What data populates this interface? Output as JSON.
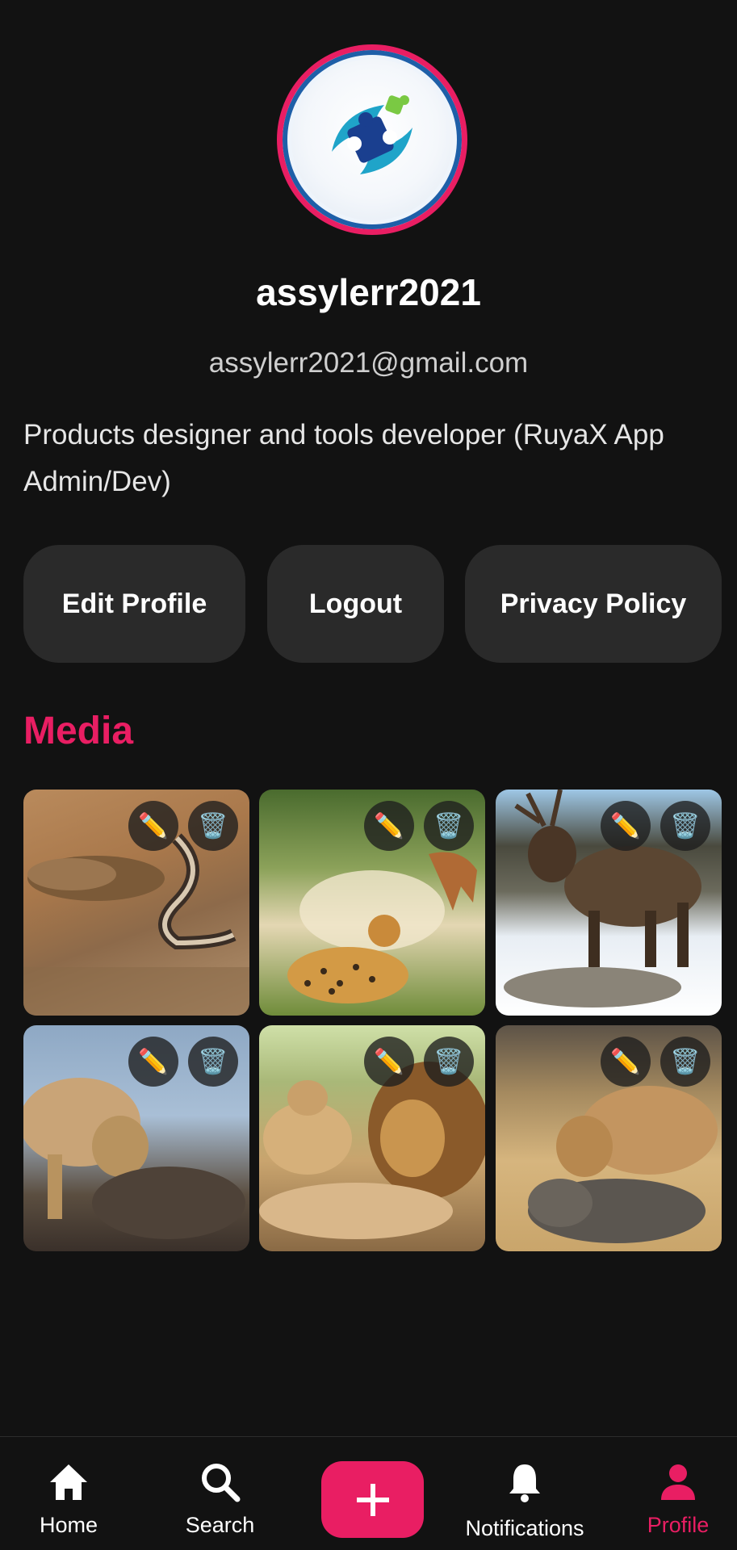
{
  "profile": {
    "username": "assylerr2021",
    "email": "assylerr2021@gmail.com",
    "bio": "Products designer and tools developer (RuyaX App Admin/Dev)",
    "avatar_icon": "puzzle-logo-icon"
  },
  "actions": {
    "edit_profile": "Edit Profile",
    "logout": "Logout",
    "privacy_policy": "Privacy Policy"
  },
  "media": {
    "title": "Media",
    "items": [
      {
        "subject": "meerkat-and-snake-photo"
      },
      {
        "subject": "cheetah-and-gazelle-photo"
      },
      {
        "subject": "elk-in-snow-photo"
      },
      {
        "subject": "lioness-and-calf-photo"
      },
      {
        "subject": "lions-resting-photo"
      },
      {
        "subject": "lioness-and-elephant-calf-photo"
      }
    ],
    "edit_icon": "pencil-icon",
    "delete_icon": "trash-icon"
  },
  "nav": {
    "home": "Home",
    "search": "Search",
    "add": "+",
    "notifications": "Notifications",
    "profile": "Profile",
    "active": "profile"
  },
  "colors": {
    "accent": "#e91e63",
    "background": "#121212",
    "button": "#2a2a2a"
  }
}
